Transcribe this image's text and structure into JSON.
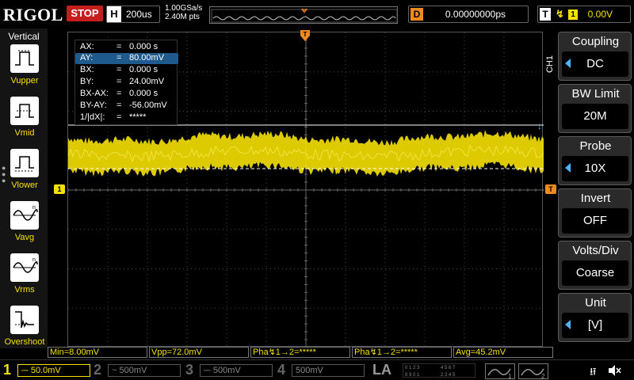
{
  "header": {
    "logo": "RIGOL",
    "run_state": "STOP",
    "horizontal_label": "H",
    "timebase": "200us",
    "sample_rate": "1.00GSa/s",
    "memory_depth": "2.40M pts",
    "delay_label": "D",
    "delay_value": "0.00000000ps",
    "trigger_label": "T",
    "trigger_edge": "↯",
    "trigger_source": "1",
    "trigger_level": "0.00V"
  },
  "left_panel": {
    "title": "Vertical",
    "items": [
      {
        "label": "Vupper",
        "icon": "vupper-icon"
      },
      {
        "label": "Vmid",
        "icon": "vmid-icon"
      },
      {
        "label": "Vlower",
        "icon": "vlower-icon"
      },
      {
        "label": "Vavg",
        "icon": "vavg-icon"
      },
      {
        "label": "Vrms",
        "icon": "vrms-icon"
      },
      {
        "label": "Overshoot",
        "icon": "overshoot-icon"
      }
    ]
  },
  "cursors": [
    {
      "key": "AX:",
      "value": "0.000 s",
      "selected": false
    },
    {
      "key": "AY:",
      "value": "80.00mV",
      "selected": true
    },
    {
      "key": "BX:",
      "value": "0.000 s",
      "selected": false
    },
    {
      "key": "BY:",
      "value": "24.00mV",
      "selected": false
    },
    {
      "key": "BX-AX:",
      "value": "0.000 s",
      "selected": false
    },
    {
      "key": "BY-AY:",
      "value": "-56.00mV",
      "selected": false
    },
    {
      "key": "1/|dX|:",
      "value": "*****",
      "selected": false
    }
  ],
  "markers": {
    "ch1": "1",
    "trigger": "T"
  },
  "right_panel": {
    "channel_label": "CH1",
    "items": [
      {
        "title": "Coupling",
        "value": "DC",
        "arrow": true
      },
      {
        "title": "BW Limit",
        "value": "20M",
        "arrow": false
      },
      {
        "title": "Probe",
        "value": "10X",
        "arrow": true
      },
      {
        "title": "Invert",
        "value": "OFF",
        "arrow": false
      },
      {
        "title": "Volts/Div",
        "value": "Coarse",
        "arrow": false
      },
      {
        "title": "Unit",
        "value": "[V]",
        "arrow": true
      }
    ]
  },
  "measurements": [
    "Min=8.00mV",
    "Vpp=72.0mV",
    "Pha↯1→2=*****",
    "Pha↯1→2=*****",
    "Avg=45.2mV"
  ],
  "bottom": {
    "channels": [
      {
        "num": "1",
        "coupling": "⎓",
        "scale": "50.0mV",
        "active": true
      },
      {
        "num": "2",
        "coupling": "~",
        "scale": "500mV",
        "active": false
      },
      {
        "num": "3",
        "coupling": "⎓",
        "scale": "500mV",
        "active": false
      },
      {
        "num": "4",
        "coupling": "",
        "scale": "500mV",
        "active": false
      }
    ],
    "la_label": "LA",
    "gen1": "1",
    "gen2": "2"
  },
  "colors": {
    "ch1": "#f5e000",
    "trigger": "#f08a1c",
    "stop": "#c41e1e",
    "cursor_select": "#1e5a8c"
  }
}
